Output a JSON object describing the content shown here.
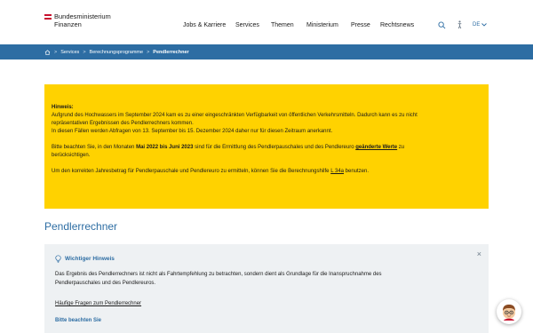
{
  "header": {
    "logo_line1": "Bundesministerium",
    "logo_line2": "Finanzen",
    "nav": [
      "Jobs & Karriere",
      "Services",
      "Themen",
      "Ministerium",
      "Presse",
      "Rechtsnews"
    ],
    "lang": "DE"
  },
  "breadcrumb": {
    "items": [
      "Services",
      "Berechnungsprogramme",
      "Pendlerrechner"
    ]
  },
  "notice": {
    "heading": "Hinweis:",
    "p1_line1": "Aufgrund des Hochwassers im September 2024 kam es zu einer eingeschränkten Verfügbarkeit von öffentlichen Verkehrsmitteln. Dadurch kann es zu nicht",
    "p1_line2": "repräsentativen Ergebnissen des Pendlerrechners kommen.",
    "p1_line3": "In diesen Fällen werden Abfragen von 13. September bis 15. Dezember 2024 daher nur für diesen Zeitraum anerkannt.",
    "p2_a": "Bitte beachten Sie, in den Monaten ",
    "p2_bold": "Mai 2022 bis Juni 2023",
    "p2_b": " sind für die Ermittlung des Pendlerpauschales und des Pendlereuro ",
    "p2_link": "geänderte Werte",
    "p2_c": " zu",
    "p2_line2": "berücksichtigen.",
    "p3_a": "Um den korrekten Jahresbetrag für Pendlerpauschale und Pendlereuro zu ermitteln, können Sie die Berechnungshilfe ",
    "p3_link": "L 34a",
    "p3_b": " benutzen."
  },
  "page_title": "Pendlerrechner",
  "info": {
    "heading": "Wichtiger Hinweis",
    "text_line1": "Das Ergebnis des Pendlerrechners ist nicht als Fahrtempfehlung zu betrachten, sondern dient als Grundlage für die Inanspruchnahme des",
    "text_line2": "Pendlerpauschales und des Pendlereuros.",
    "link": "Häufige Fragen zum Pendlerrechner",
    "subheading": "Bitte beachten Sie"
  },
  "colors": {
    "brand_blue": "#2d6da3",
    "notice_yellow": "#ffd200",
    "flag_red": "#c8102e"
  },
  "icons": [
    "austria-flag-icon",
    "search-icon",
    "accessibility-icon",
    "chevron-down-icon",
    "home-icon",
    "lightbulb-icon",
    "close-icon",
    "assistant-avatar-icon"
  ]
}
